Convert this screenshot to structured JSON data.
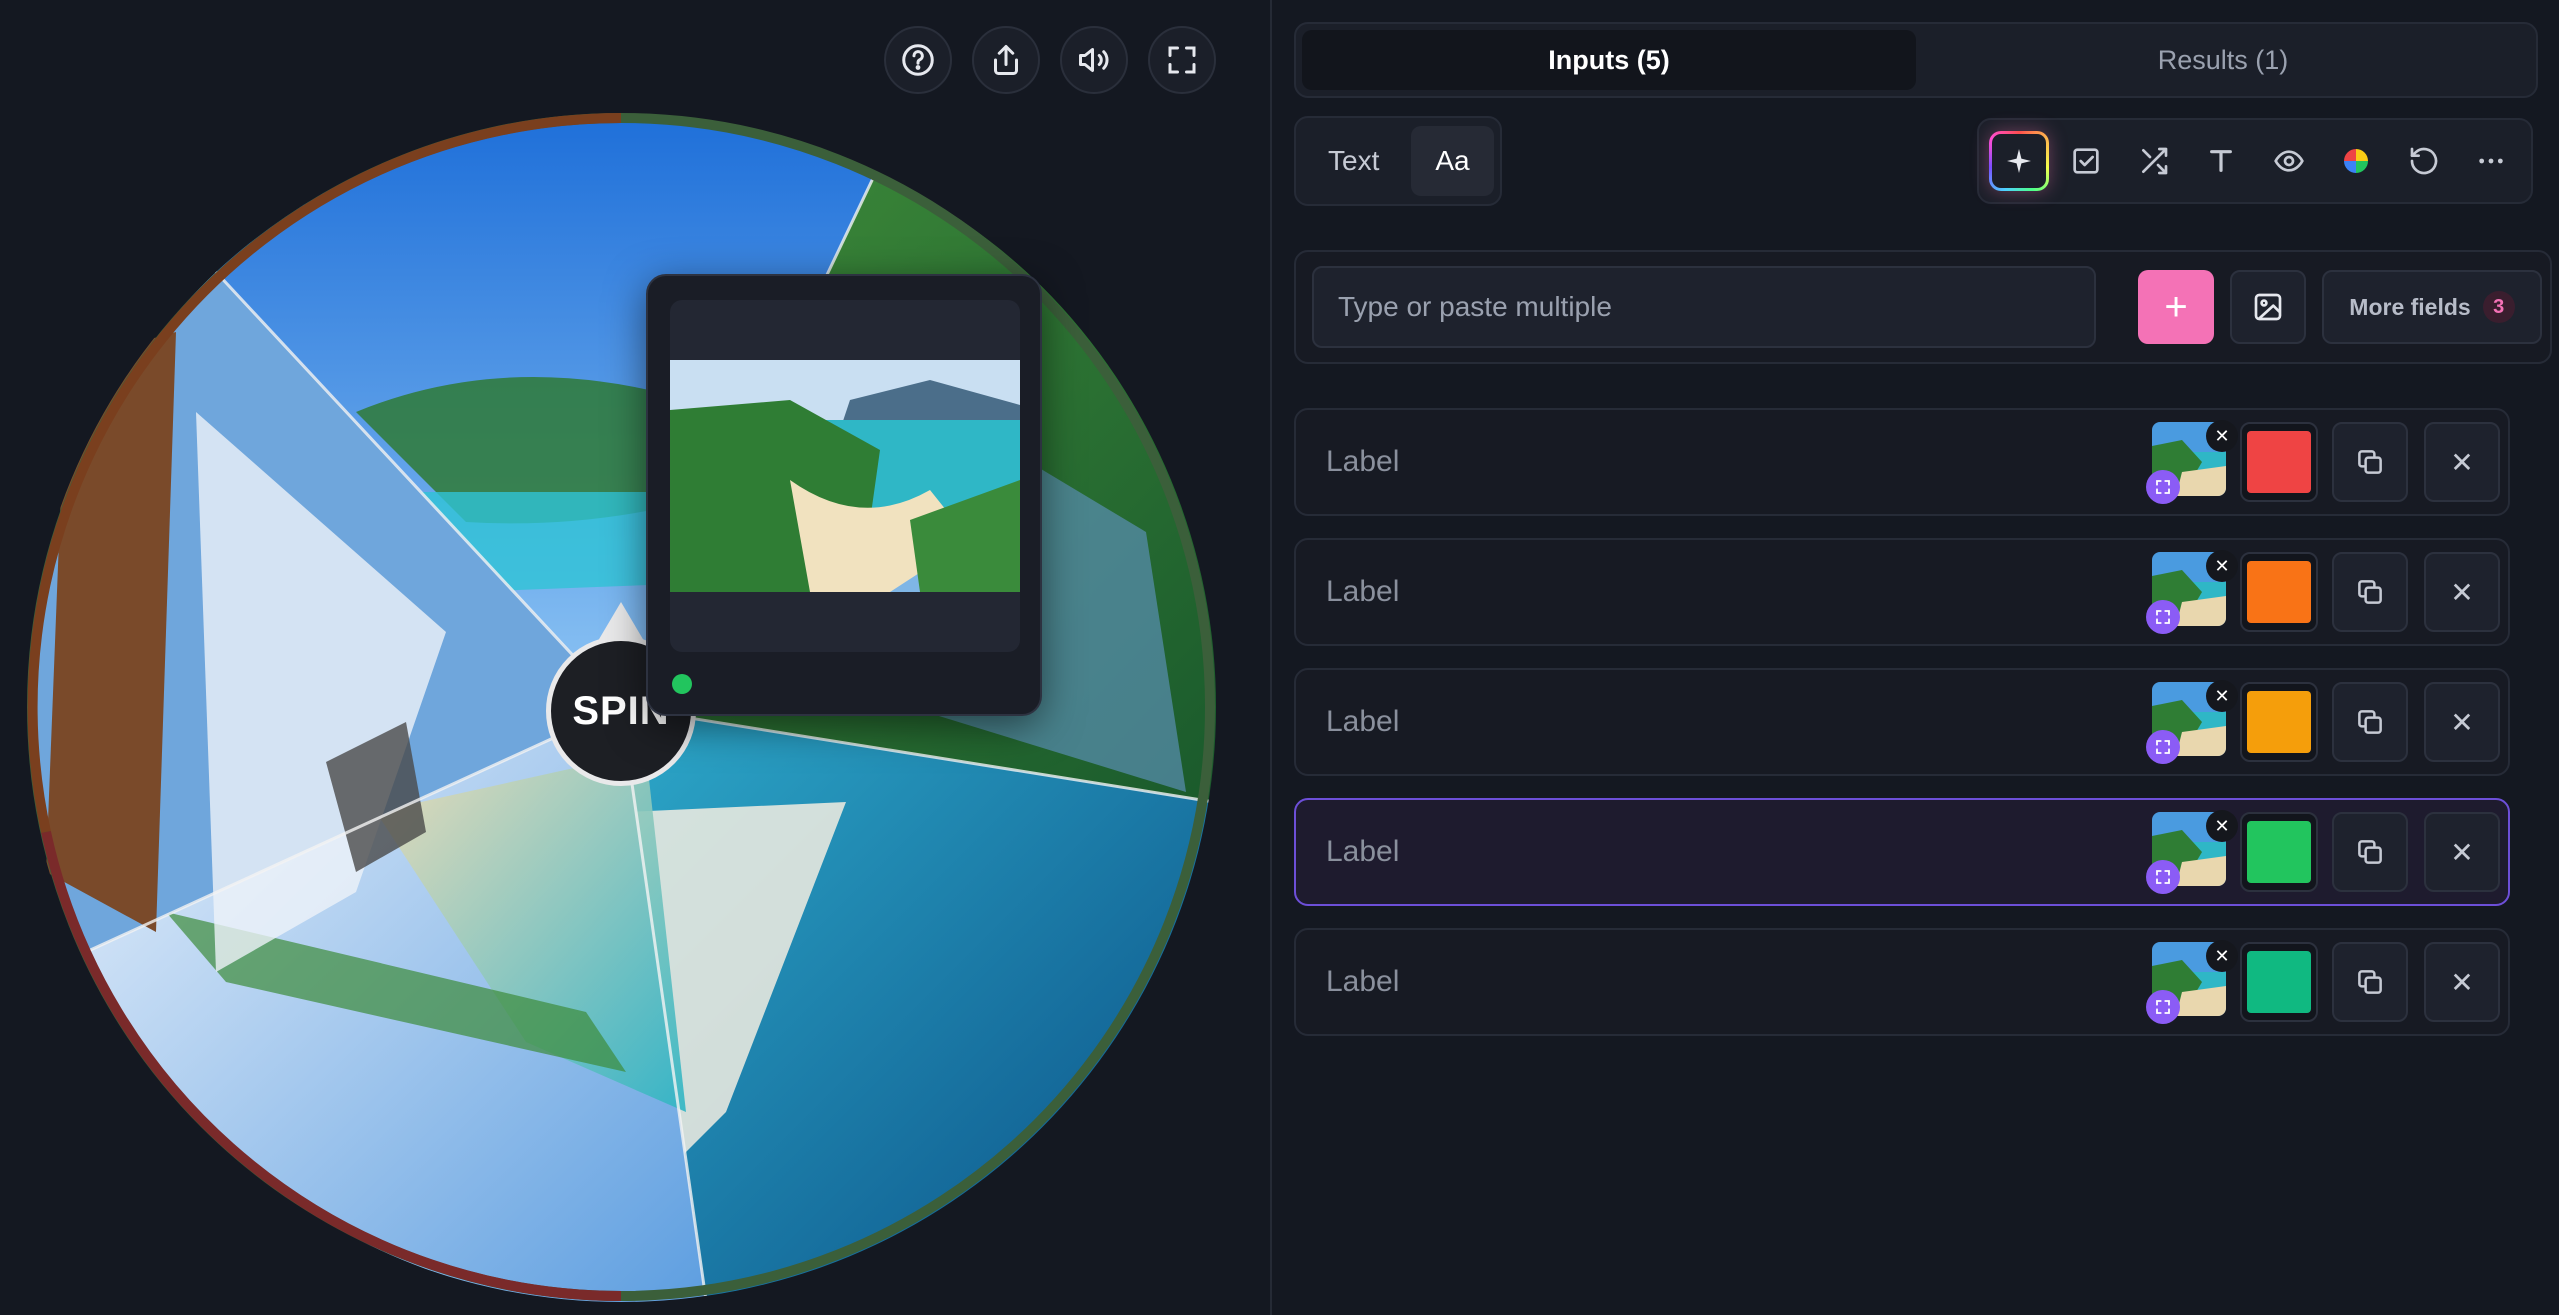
{
  "header_tools": [
    {
      "name": "help-icon"
    },
    {
      "name": "share-icon"
    },
    {
      "name": "sound-icon"
    },
    {
      "name": "fullscreen-icon"
    }
  ],
  "wheel": {
    "spin_label": "SPIN",
    "ring_colors": [
      "#ef4444",
      "#f97316",
      "#f59e0b",
      "#22c55e",
      "#10b981"
    ]
  },
  "tabs": [
    {
      "label": "Inputs (5)",
      "active": true
    },
    {
      "label": "Results (1)",
      "active": false
    }
  ],
  "mode": {
    "text_label": "Text",
    "case_label": "Aa"
  },
  "toolbar": [
    {
      "name": "ai-sparkle-icon"
    },
    {
      "name": "checkbox-icon"
    },
    {
      "name": "shuffle-icon"
    },
    {
      "name": "text-format-icon"
    },
    {
      "name": "eye-icon"
    },
    {
      "name": "color-wheel-icon"
    },
    {
      "name": "reset-icon"
    },
    {
      "name": "more-icon"
    }
  ],
  "entry": {
    "placeholder": "Type or paste multiple",
    "add_label": "+",
    "more_fields_label": "More fields",
    "more_fields_count": "3"
  },
  "items": [
    {
      "label_placeholder": "Label",
      "color": "#ef4444",
      "active": false
    },
    {
      "label_placeholder": "Label",
      "color": "#f97316",
      "active": false
    },
    {
      "label_placeholder": "Label",
      "color": "#f59e0b",
      "active": false
    },
    {
      "label_placeholder": "Label",
      "color": "#22c55e",
      "active": true
    },
    {
      "label_placeholder": "Label",
      "color": "#10b981",
      "active": false
    }
  ]
}
